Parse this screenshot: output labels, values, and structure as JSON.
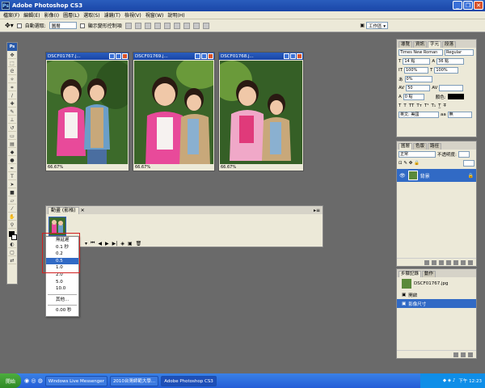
{
  "app": {
    "title": "Adobe Photoshop CS3",
    "logo": "Ps"
  },
  "menu": [
    "檔案(F)",
    "編輯(E)",
    "影像(I)",
    "圖層(L)",
    "選取(S)",
    "濾鏡(T)",
    "檢視(V)",
    "視窗(W)",
    "說明(H)"
  ],
  "options": {
    "auto_select": "自動選取:",
    "auto_select_value": "圖層",
    "transform": "顯示變形控制項",
    "workspace": "工作區 ▾"
  },
  "documents": [
    {
      "title": "DSCF01767.j...",
      "zoom": "66.67%"
    },
    {
      "title": "DSCF01769.j...",
      "zoom": "66.67%"
    },
    {
      "title": "DSCF01768.j...",
      "zoom": "66.67%"
    }
  ],
  "animation": {
    "tab": "動畫 (影格)",
    "frame_number": "1",
    "frame_delay": "0 秒"
  },
  "delay_menu": [
    "無延遲",
    "0.1 秒",
    "0.2",
    "0.5",
    "1.0",
    "2.0",
    "5.0",
    "10.0",
    "其他...",
    "0.00 秒"
  ],
  "delay_selected": "0.5",
  "char_panel": {
    "tabs": [
      "導覽",
      "資訊",
      "字元",
      "段落"
    ],
    "font": "Times New Roman",
    "style": "Regular",
    "size": "14 點",
    "leading": "36 點",
    "vscale": "100%",
    "hscale": "100%",
    "tracking": "0%",
    "kerning": "50",
    "baseline": "0 點",
    "color_label": "顏色:",
    "lang": "英文: 美國",
    "aa": "無"
  },
  "layers_panel": {
    "tabs": [
      "圖層",
      "色版",
      "路徑"
    ],
    "blend": "正常",
    "opacity_label": "不透明度:",
    "layer_name": "背景"
  },
  "history_panel": {
    "tabs": [
      "步驟記錄",
      "動作"
    ],
    "snapshot": "DSCF01767.jpg",
    "items": [
      "開啟",
      "影像尺寸"
    ]
  },
  "taskbar": {
    "start": "開始",
    "items": [
      "Windows Live Messenger",
      "2010台灣師範大學...",
      "Adobe Photoshop CS3"
    ],
    "clock": "下午 12:23"
  },
  "colors": {
    "title_blue": "#1a46a8",
    "select_blue": "#316ac5",
    "highlight_red": "#d02020"
  }
}
